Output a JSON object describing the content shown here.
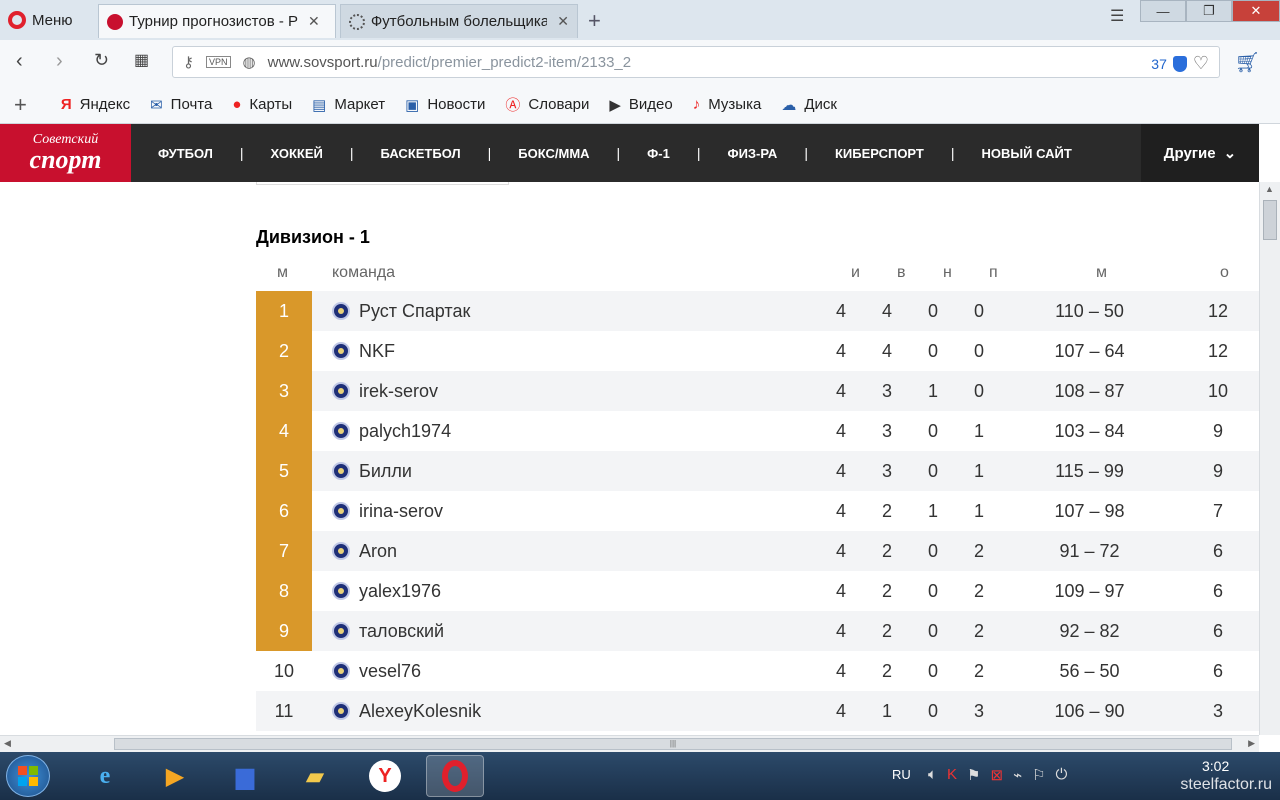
{
  "browser": {
    "menu_label": "Меню",
    "tabs": [
      {
        "label": "Турнир прогнозистов - Р"
      },
      {
        "label": "Футбольным болельщика"
      }
    ],
    "address": {
      "host": "www.sovsport.ru",
      "path": "/predict/premier_predict2-item/2133_2",
      "vpn": "VPN",
      "counter": "37"
    },
    "bookmarks": [
      {
        "label": "Яндекс",
        "icon": "yandex-icon"
      },
      {
        "label": "Почта",
        "icon": "mail-icon"
      },
      {
        "label": "Карты",
        "icon": "map-pin-icon"
      },
      {
        "label": "Маркет",
        "icon": "market-icon"
      },
      {
        "label": "Новости",
        "icon": "news-icon"
      },
      {
        "label": "Словари",
        "icon": "dictionary-icon"
      },
      {
        "label": "Видео",
        "icon": "video-icon"
      },
      {
        "label": "Музыка",
        "icon": "music-icon"
      },
      {
        "label": "Диск",
        "icon": "disk-icon"
      }
    ]
  },
  "site": {
    "logo_line1": "Советский",
    "logo_line2": "спорт",
    "nav": [
      "ФУТБОЛ",
      "ХОККЕЙ",
      "БАСКЕТБОЛ",
      "БОКС/ММА",
      "Ф-1",
      "ФИЗ-РА",
      "КИБЕРСПОРТ",
      "НОВЫЙ САЙТ"
    ],
    "others_label": "Другие"
  },
  "division_title": "Дивизион - 1",
  "columns": {
    "pos": "м",
    "team": "команда",
    "played": "и",
    "won": "в",
    "draw": "н",
    "lost": "п",
    "score": "м",
    "points": "о"
  },
  "rows": [
    {
      "pos": "1",
      "team": "Руст Спартак",
      "played": "4",
      "won": "4",
      "draw": "0",
      "lost": "0",
      "score": "110 – 50",
      "points": "12"
    },
    {
      "pos": "2",
      "team": "NKF",
      "played": "4",
      "won": "4",
      "draw": "0",
      "lost": "0",
      "score": "107 – 64",
      "points": "12"
    },
    {
      "pos": "3",
      "team": "irek-serov",
      "played": "4",
      "won": "3",
      "draw": "1",
      "lost": "0",
      "score": "108 – 87",
      "points": "10"
    },
    {
      "pos": "4",
      "team": "palych1974",
      "played": "4",
      "won": "3",
      "draw": "0",
      "lost": "1",
      "score": "103 – 84",
      "points": "9"
    },
    {
      "pos": "5",
      "team": "Билли",
      "played": "4",
      "won": "3",
      "draw": "0",
      "lost": "1",
      "score": "115 – 99",
      "points": "9"
    },
    {
      "pos": "6",
      "team": "irina-serov",
      "played": "4",
      "won": "2",
      "draw": "1",
      "lost": "1",
      "score": "107 – 98",
      "points": "7"
    },
    {
      "pos": "7",
      "team": "Aron",
      "played": "4",
      "won": "2",
      "draw": "0",
      "lost": "2",
      "score": "91 – 72",
      "points": "6"
    },
    {
      "pos": "8",
      "team": "yalex1976",
      "played": "4",
      "won": "2",
      "draw": "0",
      "lost": "2",
      "score": "109 – 97",
      "points": "6"
    },
    {
      "pos": "9",
      "team": "таловский",
      "played": "4",
      "won": "2",
      "draw": "0",
      "lost": "2",
      "score": "92 – 82",
      "points": "6"
    },
    {
      "pos": "10",
      "team": "vesel76",
      "played": "4",
      "won": "2",
      "draw": "0",
      "lost": "2",
      "score": "56 – 50",
      "points": "6"
    },
    {
      "pos": "11",
      "team": "AlexeyKolesnik",
      "played": "4",
      "won": "1",
      "draw": "0",
      "lost": "3",
      "score": "106 – 90",
      "points": "3"
    }
  ],
  "highlighted_positions": 9,
  "colors": {
    "accent_red": "#c8102e",
    "highlight_gold": "#d9982a",
    "header_dark": "#2b2b2b"
  },
  "taskbar": {
    "lang": "RU",
    "time": "3:02",
    "watermark": "steelfactor.ru"
  }
}
